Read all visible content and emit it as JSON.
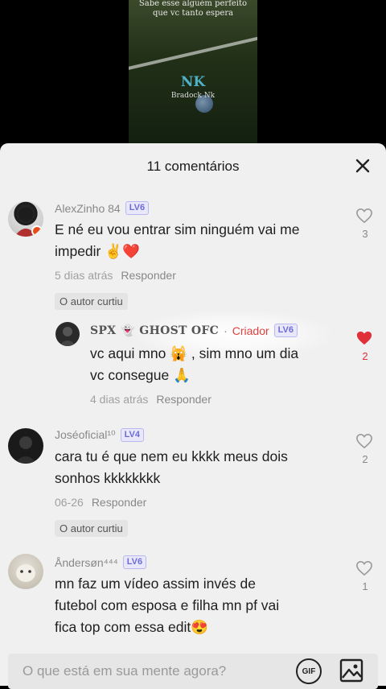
{
  "video": {
    "caption_line1": "Sabe esse alguém perfeito",
    "caption_line2": "que vc tanto espera",
    "logo": "NK",
    "logo_sub": "Bradock Nk"
  },
  "panel": {
    "title": "11 comentários"
  },
  "comments": [
    {
      "author": "AlexZinho 84",
      "level": "LV6",
      "text_line1": "E né eu vou entrar sim ninguém vai me",
      "text_line2": "impedir ✌️❤️",
      "time": "5 dias atrás",
      "reply": "Responder",
      "liked_badge": "O autor curtiu",
      "likes": "3"
    },
    {
      "author": "SPX",
      "author_deco": "👻 GHOST OFC",
      "separator": "·",
      "creator_tag": "Criador",
      "level": "LV6",
      "text_line1": "vc aqui mno 🙀 , sim mno um dia",
      "text_line2": "vc consegue 🙏",
      "time": "4 dias atrás",
      "reply": "Responder",
      "likes": "2"
    },
    {
      "author": "Joséoficial¹⁰",
      "level": "LV4",
      "text_line1": "cara tu é que nem eu kkkk meus dois",
      "text_line2": "sonhos kkkkkkkk",
      "time": "06-26",
      "reply": "Responder",
      "liked_badge": "O autor curtiu",
      "likes": "2"
    },
    {
      "author": "Åndersøn⁴⁴⁴",
      "level": "LV6",
      "text_line1": "mn faz um vídeo assim invés de",
      "text_line2": "futebol com esposa e filha mn pf vai",
      "text_line3": "fica top com essa edit😍",
      "likes": "1"
    }
  ],
  "input": {
    "placeholder": "O que está em sua mente agora?",
    "gif_label": "GIF"
  },
  "colors": {
    "panel_bg": "#f0f0f0",
    "level_badge": "#6c6cd8",
    "liked_heart": "#e0303a",
    "creator": "#e04040"
  }
}
